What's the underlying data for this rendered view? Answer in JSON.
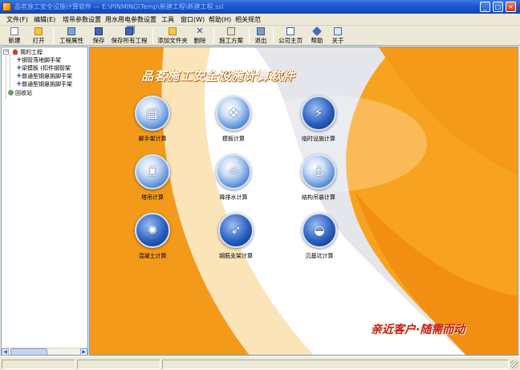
{
  "window": {
    "title": "品茗施工安全设施计算软件 — E:\\PINMING\\Temp\\新建工程\\新建工程.ssl",
    "buttons": [
      "_",
      "□",
      "×"
    ]
  },
  "menu": [
    "文件(F)",
    "编辑(E)",
    "塔吊参数设置",
    "用水用电参数设置",
    "工具",
    "窗口(W)",
    "帮助(H)",
    "相关规范"
  ],
  "toolbar": [
    {
      "label": "新建",
      "icon": "new-file-icon"
    },
    {
      "label": "打开",
      "icon": "open-folder-icon"
    },
    {
      "label": "工程属性",
      "icon": "project-properties-icon"
    },
    {
      "label": "保存",
      "icon": "save-icon"
    },
    {
      "label": "保存所有工程",
      "icon": "save-all-icon"
    },
    {
      "label": "添加文件夹",
      "icon": "add-folder-icon"
    },
    {
      "label": "删除",
      "icon": "delete-icon"
    },
    {
      "label": "施工方案",
      "icon": "construction-plan-icon"
    },
    {
      "label": "退出",
      "icon": "exit-icon"
    },
    {
      "label": "公司主页",
      "icon": "homepage-icon"
    },
    {
      "label": "帮助",
      "icon": "help-icon"
    },
    {
      "label": "关于",
      "icon": "about-icon"
    }
  ],
  "tree": {
    "root": "我的工程",
    "children": [
      "钢管落地脚手架",
      "梁模板 (扣件钢管架",
      "普通型钢悬挑脚手架",
      "普通型钢悬挑脚手架"
    ],
    "recycle": "回收站"
  },
  "main": {
    "banner": "品茗施工安全设施计算软件",
    "slogan": "亲近客户·随需而动",
    "calculators": [
      {
        "label": "脚手架计算",
        "icon": "scaffold-icon",
        "glyph": "▦"
      },
      {
        "label": "模板计算",
        "icon": "formwork-icon",
        "glyph": "❖"
      },
      {
        "label": "临时设施计算",
        "icon": "temporary-facility-icon",
        "glyph": "⚡"
      },
      {
        "label": "塔吊计算",
        "icon": "tower-crane-icon",
        "glyph": "♜"
      },
      {
        "label": "降排水计算",
        "icon": "dewatering-icon",
        "glyph": "☼"
      },
      {
        "label": "结构吊装计算",
        "icon": "structural-hoisting-icon",
        "glyph": "⚓"
      },
      {
        "label": "混凝土计算",
        "icon": "concrete-icon",
        "glyph": "✺"
      },
      {
        "label": "钢筋支架计算",
        "icon": "rebar-support-icon",
        "glyph": "➶"
      },
      {
        "label": "沉基坑计算",
        "icon": "foundation-pit-icon",
        "glyph": "◒"
      }
    ]
  },
  "colors": {
    "background_orange": "#f7a31f",
    "slogan_red": "#c4201b",
    "titlebar_blue": "#1f57cf"
  }
}
